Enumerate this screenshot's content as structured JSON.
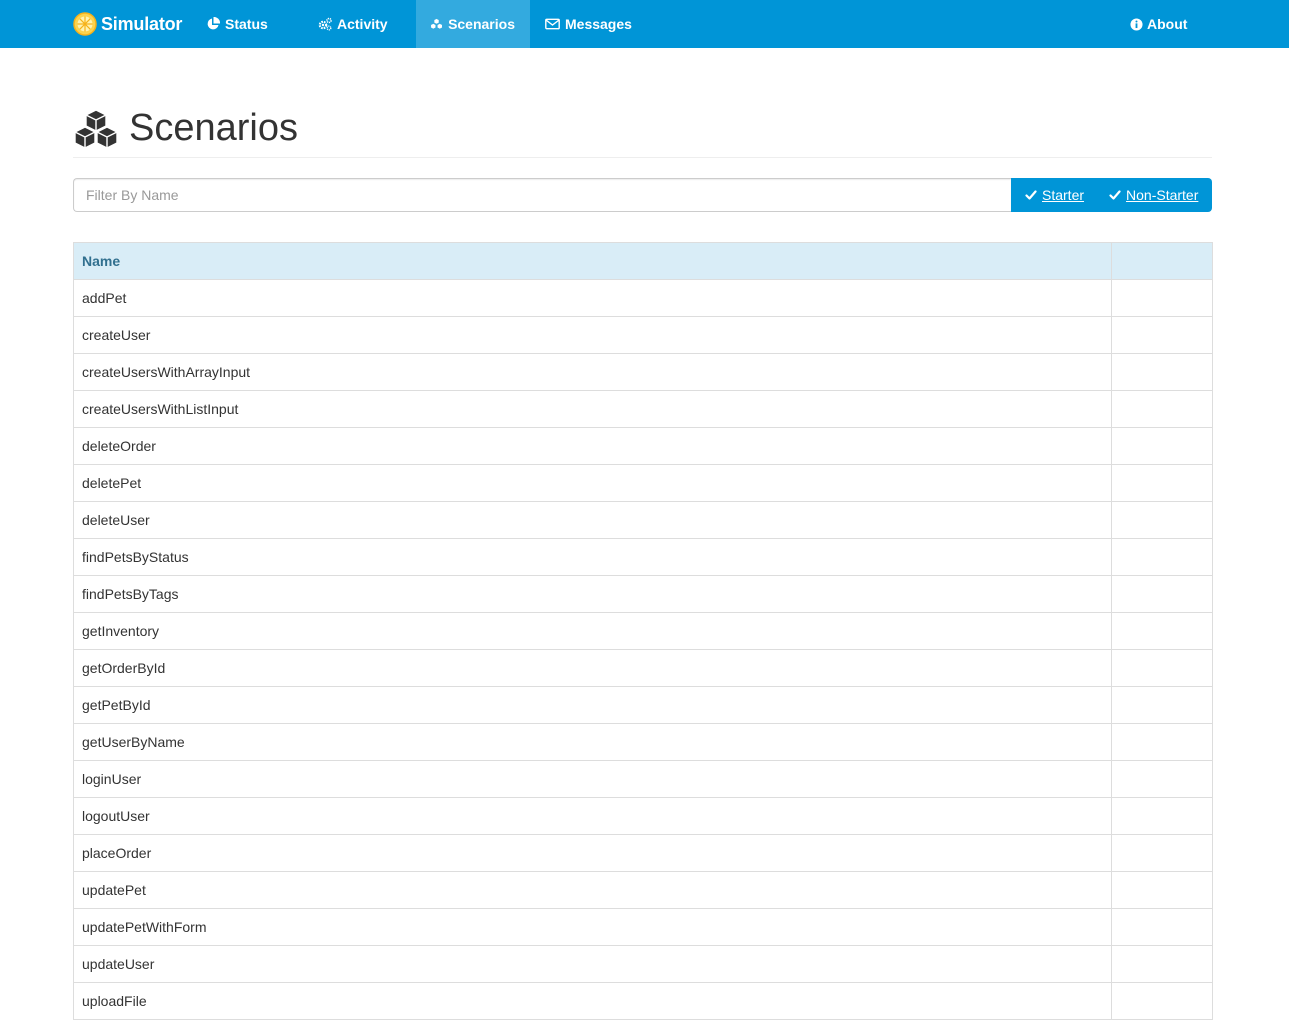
{
  "navbar": {
    "brand": "Simulator",
    "items": [
      {
        "label": "Status",
        "icon": "pie-chart-icon"
      },
      {
        "label": "Activity",
        "icon": "cogs-icon"
      },
      {
        "label": "Scenarios",
        "icon": "cubes-icon",
        "active": true
      },
      {
        "label": "Messages",
        "icon": "envelope-icon"
      }
    ],
    "about": {
      "label": "About",
      "icon": "info-circle-icon"
    },
    "colors": {
      "background": "#0095d7",
      "active": "#33aadf"
    }
  },
  "page": {
    "title": "Scenarios",
    "icon": "cubes-icon"
  },
  "filter": {
    "placeholder": "Filter By Name",
    "value": "",
    "starter_label": "Starter",
    "non_starter_label": "Non-Starter",
    "starter_checked": true,
    "non_starter_checked": true
  },
  "table": {
    "columns": [
      "Name",
      ""
    ],
    "rows": [
      "addPet",
      "createUser",
      "createUsersWithArrayInput",
      "createUsersWithListInput",
      "deleteOrder",
      "deletePet",
      "deleteUser",
      "findPetsByStatus",
      "findPetsByTags",
      "getInventory",
      "getOrderById",
      "getPetById",
      "getUserByName",
      "loginUser",
      "logoutUser",
      "placeOrder",
      "updatePet",
      "updatePetWithForm",
      "updateUser",
      "uploadFile"
    ]
  }
}
